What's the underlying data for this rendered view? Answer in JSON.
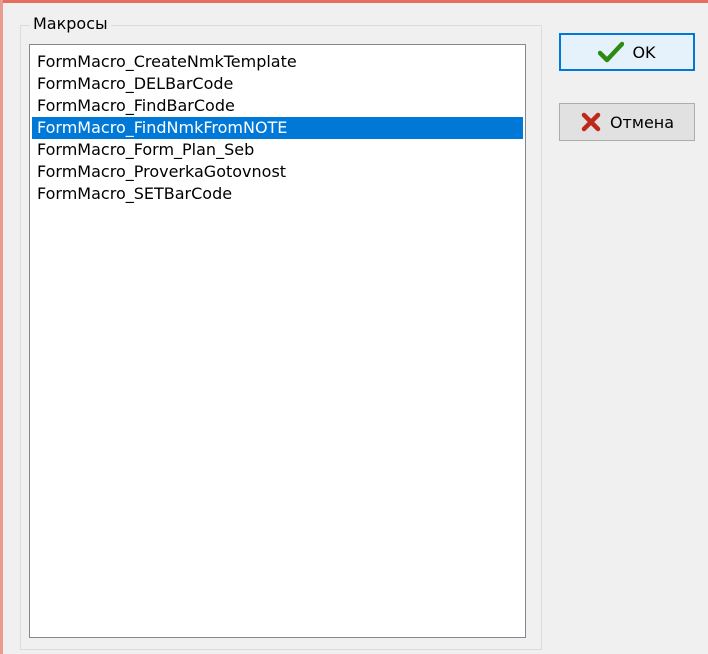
{
  "group": {
    "title": "Макросы"
  },
  "macros": {
    "items": [
      "FormMacro_CreateNmkTemplate",
      "FormMacro_DELBarCode",
      "FormMacro_FindBarCode",
      "FormMacro_FindNmkFromNOTE",
      "FormMacro_Form_Plan_Seb",
      "FormMacro_ProverkaGotovnost",
      "FormMacro_SETBarCode"
    ],
    "selected_index": 3
  },
  "buttons": {
    "ok_label": "OK",
    "cancel_label": "Отмена",
    "ok_icon": "checkmark-icon",
    "cancel_icon": "cross-icon"
  },
  "colors": {
    "selection": "#0078d7",
    "ok_icon": "#2e8b12",
    "cancel_icon": "#c0281a",
    "window_border": "#e46f5d"
  }
}
